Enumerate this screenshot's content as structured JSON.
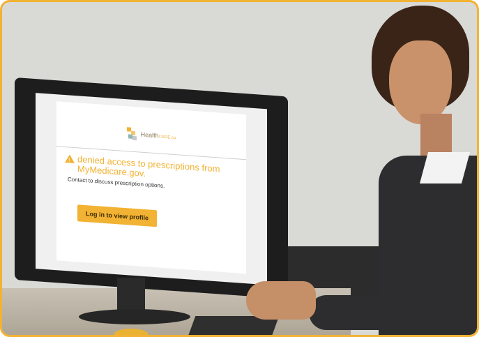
{
  "screen": {
    "logo": {
      "brand": "Health",
      "suffix": "CARE co"
    },
    "alert": {
      "title": "denied access to prescriptions from MyMedicare.gov.",
      "body": "Contact to discuss prescription options."
    },
    "button": {
      "label": "Log in to view profile"
    }
  },
  "colors": {
    "accent": "#f2b233",
    "frame_border": "#f2b233",
    "button_text": "#3a2a00"
  },
  "icons": {
    "alert": "warning-triangle-icon",
    "logo": "healthcare-logo-icon"
  }
}
